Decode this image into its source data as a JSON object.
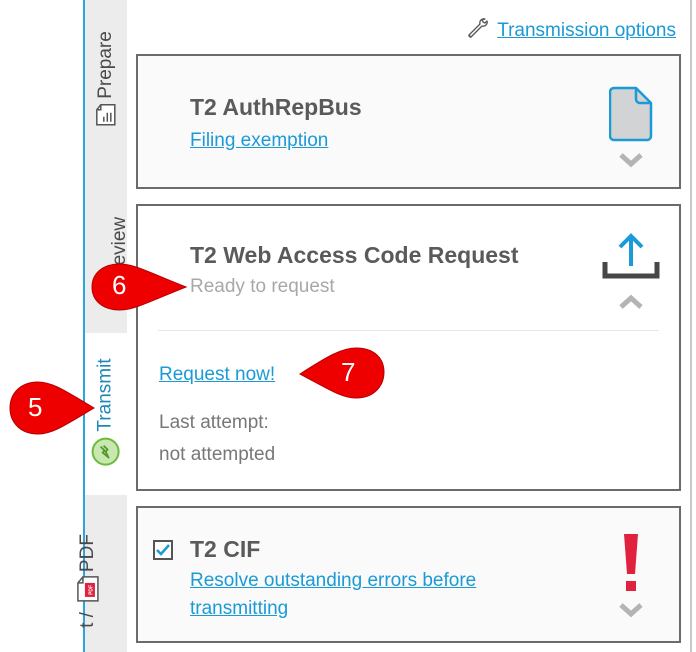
{
  "sidebar": {
    "tabs": [
      {
        "label": "Prepare",
        "icon": "form-chart-icon",
        "active": false
      },
      {
        "label": "Review",
        "icon": "review-icon",
        "active": false
      },
      {
        "label": "Transmit",
        "icon": "lightning-circle-icon",
        "active": true
      },
      {
        "label": "Print / PDF",
        "visible_label": "t / PDF",
        "icon": "pdf-file-icon",
        "active": false
      }
    ]
  },
  "header": {
    "options_link": "Transmission options",
    "options_icon": "wrench-icon"
  },
  "cards": [
    {
      "title": "T2 AuthRepBus",
      "link": "Filing exemption",
      "status_icon": "document-icon",
      "toggle": "expand",
      "expanded": false
    },
    {
      "title": "T2 Web Access Code Request",
      "status": "Ready to request",
      "status_icon": "upload-icon",
      "toggle": "collapse",
      "expanded": true,
      "action_link": "Request now!",
      "last_attempt_label": "Last attempt:",
      "last_attempt_value": "not attempted"
    },
    {
      "title": "T2 CIF",
      "checked": true,
      "link": "Resolve outstanding errors before transmitting",
      "link_line1": "Resolve outstanding errors before",
      "link_line2": "transmitting",
      "status_icon": "error-exclamation-icon",
      "toggle": "expand",
      "expanded": false
    }
  ],
  "callouts": [
    {
      "number": "5",
      "target": "Transmit tab"
    },
    {
      "number": "6",
      "target": "Ready to request status"
    },
    {
      "number": "7",
      "target": "Request now! link"
    }
  ],
  "colors": {
    "accent": "#1a9ad6",
    "callout": "#ee0000",
    "error": "#e0223f",
    "transmit_green": "#7cc34a"
  }
}
